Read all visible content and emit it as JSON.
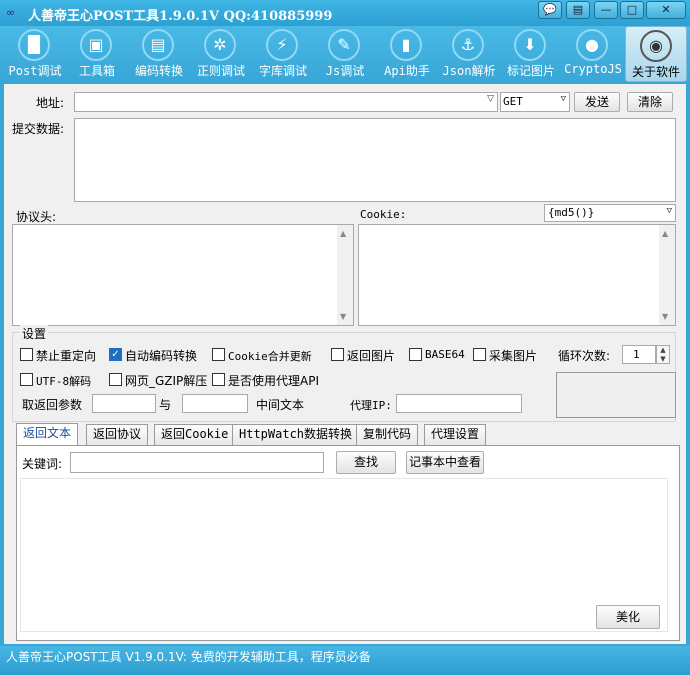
{
  "window": {
    "title": "人善帝王心POST工具1.9.0.1V  QQ:410885999",
    "min": "—",
    "max": "□",
    "close": "✕",
    "extra1": "💬",
    "extra2": "▤"
  },
  "toolbar": [
    {
      "label": "Post调试",
      "icon": "▐▌"
    },
    {
      "label": "工具箱",
      "icon": "▣"
    },
    {
      "label": "编码转换",
      "icon": "▤"
    },
    {
      "label": "正则调试",
      "icon": "✲"
    },
    {
      "label": "字库调试",
      "icon": "⚡"
    },
    {
      "label": "Js调试",
      "icon": "✎"
    },
    {
      "label": "Api助手",
      "icon": "▮"
    },
    {
      "label": "Json解析",
      "icon": "⚓"
    },
    {
      "label": "标记图片",
      "icon": "⬇"
    },
    {
      "label": "CryptoJS",
      "icon": "●"
    },
    {
      "label": "关于软件",
      "icon": "◉"
    }
  ],
  "request": {
    "address_label": "地址:",
    "address_value": "",
    "method": "GET",
    "send": "发送",
    "clear": "清除",
    "postdata_label": "提交数据:"
  },
  "headers": {
    "label": "协议头:",
    "cookie_label": "Cookie:",
    "cookie_mode": "{md5()}"
  },
  "settings": {
    "group": "设置",
    "no_redirect": "禁止重定向",
    "auto_encoding": "自动编码转换",
    "cookie_merge": "Cookie合并更新",
    "return_image": "返回图片",
    "base64": "BASE64",
    "collect_image": "采集图片",
    "loop_label": "循环次数:",
    "loop_value": "1",
    "utf8": "UTF-8解码",
    "gzip": "网页_GZIP解压",
    "use_proxy": "是否使用代理API",
    "take_label": "取返回参数",
    "with_label": "与",
    "middle_label": "中间文本",
    "proxy_ip_label": "代理IP:"
  },
  "tabs": [
    "返回文本",
    "返回协议",
    "返回Cookie",
    "HttpWatch数据转换",
    "复制代码",
    "代理设置"
  ],
  "response": {
    "keyword_label": "关键词:",
    "find": "查找",
    "notepad": "记事本中查看",
    "beautify": "美化"
  },
  "status": "人善帝王心POST工具 V1.9.0.1V: 免费的开发辅助工具，程序员必备"
}
